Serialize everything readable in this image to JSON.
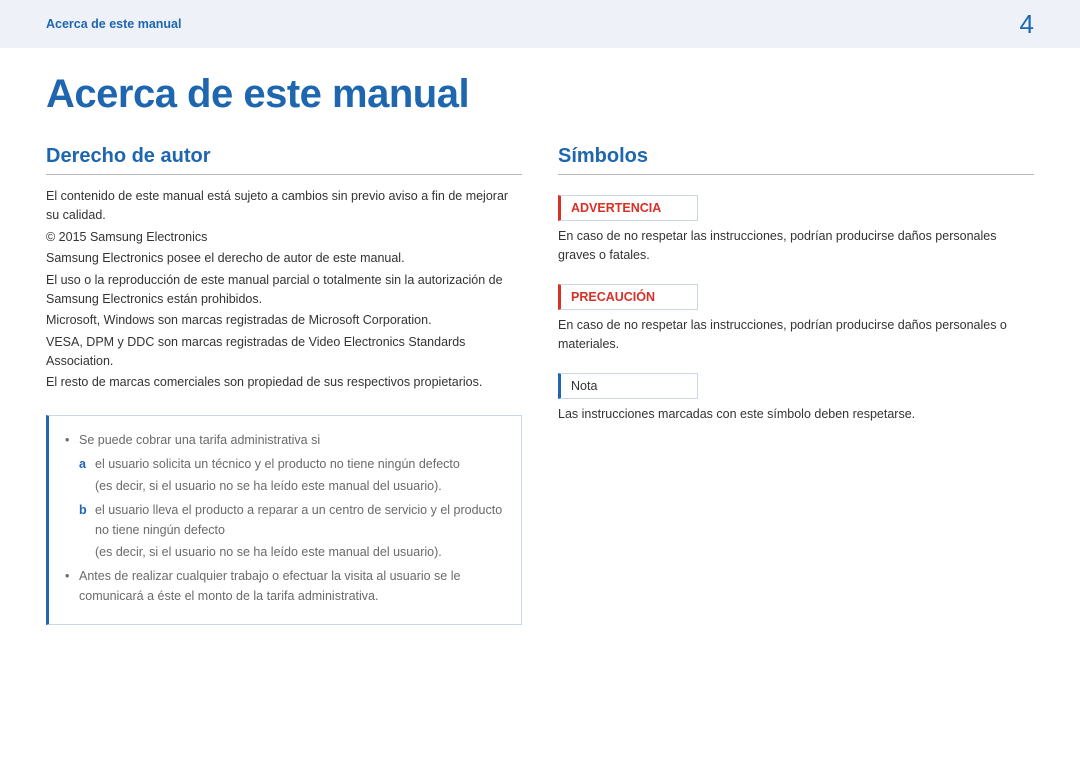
{
  "header": {
    "breadcrumb": "Acerca de este manual",
    "page_number": "4"
  },
  "title": "Acerca de este manual",
  "left": {
    "heading": "Derecho de autor",
    "p1": "El contenido de este manual está sujeto a cambios sin previo aviso a fin de mejorar su calidad.",
    "p2": "© 2015 Samsung Electronics",
    "p3": "Samsung Electronics posee el derecho de autor de este manual.",
    "p4": "El uso o la reproducción de este manual parcial o totalmente sin la autorización de Samsung Electronics están prohibidos.",
    "p5": "Microsoft, Windows son marcas registradas de Microsoft Corporation.",
    "p6": "VESA, DPM y DDC son marcas registradas de Video Electronics Standards Association.",
    "p7": "El resto de marcas comerciales son propiedad de sus respectivos propietarios.",
    "notebox": {
      "b1_intro": "Se puede cobrar una tarifa administrativa si",
      "a_letter": "a",
      "a_text": "el usuario solicita un técnico y el producto no tiene ningún defecto",
      "a_par": "(es decir, si el usuario no se ha leído este manual del usuario).",
      "b_letter": "b",
      "b_text": "el usuario lleva el producto a reparar a un centro de servicio y el producto no tiene ningún defecto",
      "b_par": "(es decir, si el usuario no se ha leído este manual del usuario).",
      "b2_text": "Antes de realizar cualquier trabajo o efectuar la visita al usuario se le comunicará a éste el monto de la tarifa administrativa."
    }
  },
  "right": {
    "heading": "Símbolos",
    "warn_label": "ADVERTENCIA",
    "warn_text": "En caso de no respetar las instrucciones, podrían producirse daños personales graves o fatales.",
    "caution_label": "PRECAUCIÓN",
    "caution_text": "En caso de no respetar las instrucciones, podrían producirse daños personales o materiales.",
    "note_label": "Nota",
    "note_text": "Las instrucciones marcadas con este símbolo deben respetarse."
  }
}
